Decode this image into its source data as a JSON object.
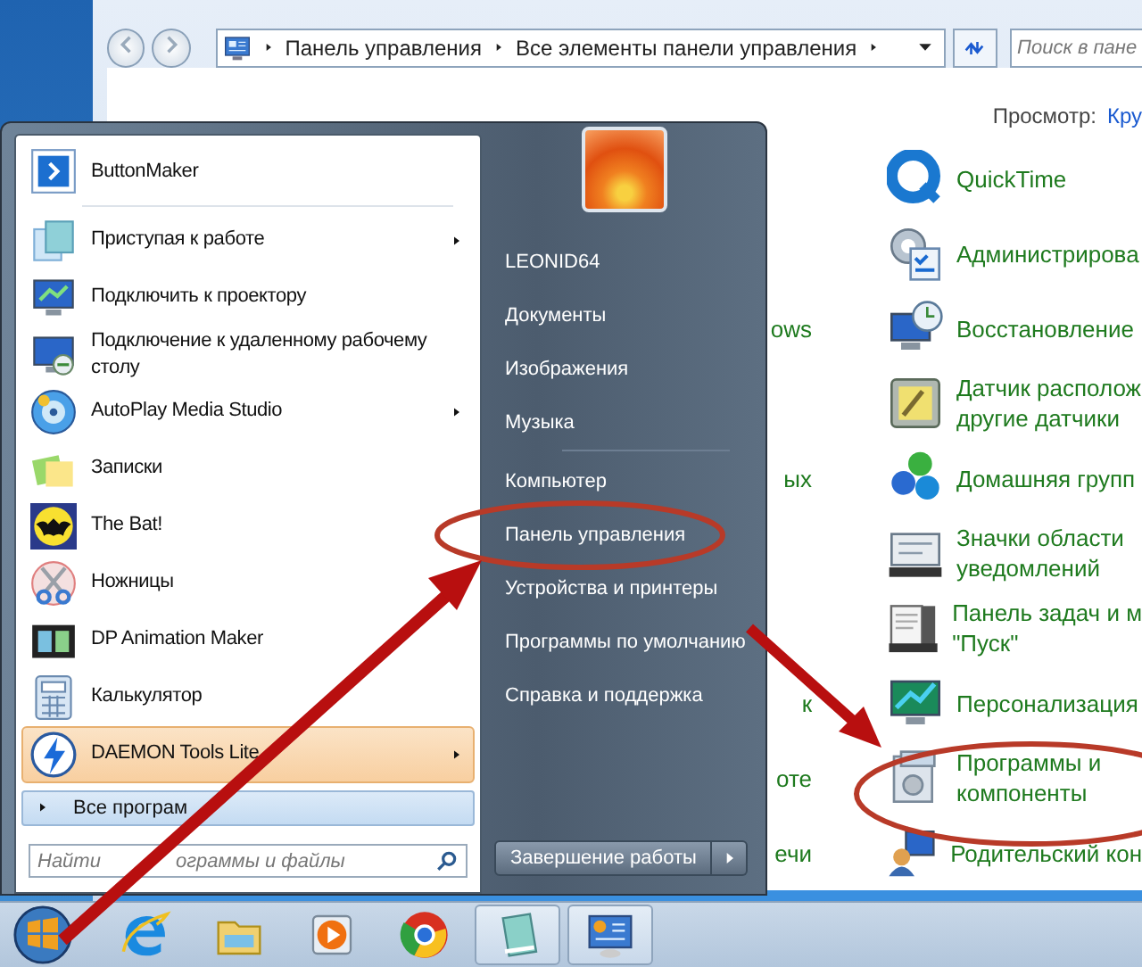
{
  "explorer": {
    "breadcrumb": [
      "Панель управления",
      "Все элементы панели управления"
    ],
    "search": {
      "placeholder": "Поиск в пане"
    },
    "view_label": "Просмотр:",
    "view_value": "Кру",
    "items": [
      {
        "lines": [
          "QuickTime"
        ]
      },
      {
        "lines": [
          "Администрирова"
        ]
      },
      {
        "lines": [
          "Восстановление"
        ],
        "left_fragment": "ows"
      },
      {
        "lines": [
          "Датчик располож",
          "другие датчики"
        ]
      },
      {
        "lines": [
          "Домашняя групп"
        ],
        "left_fragment": "ых"
      },
      {
        "lines": [
          "Значки области",
          "уведомлений"
        ]
      },
      {
        "lines": [
          "Панель задач и м",
          "\"Пуск\""
        ]
      },
      {
        "lines": [
          "Персонализация"
        ],
        "left_fragment": "к"
      },
      {
        "lines": [
          "Программы и",
          "компоненты"
        ],
        "left_fragment": "оте"
      },
      {
        "lines": [
          "Родительский кон"
        ],
        "left_fragment": "ечи"
      }
    ]
  },
  "start_menu": {
    "programs": [
      {
        "label": "ButtonMaker",
        "submenu": false,
        "selected": false
      },
      {
        "label": "Приступая к работе",
        "submenu": true,
        "selected": false
      },
      {
        "label": "Подключить к проектору",
        "submenu": false,
        "selected": false
      },
      {
        "label": "Подключение к удаленному рабочему столу",
        "submenu": false,
        "selected": false
      },
      {
        "label": "AutoPlay Media Studio",
        "submenu": true,
        "selected": false
      },
      {
        "label": "Записки",
        "submenu": false,
        "selected": false
      },
      {
        "label": "The Bat!",
        "submenu": false,
        "selected": false
      },
      {
        "label": "Ножницы",
        "submenu": false,
        "selected": false
      },
      {
        "label": "DP Animation Maker",
        "submenu": false,
        "selected": false
      },
      {
        "label": "Калькулятор",
        "submenu": false,
        "selected": false
      },
      {
        "label": "DAEMON Tools Lite",
        "submenu": true,
        "selected": true
      }
    ],
    "all_programs": "Все програм",
    "search": {
      "placeholder_parts": [
        "Найти",
        "ограммы и файлы"
      ]
    },
    "place_groups": [
      [
        "LEONID64",
        "Документы",
        "Изображения",
        "Музыка"
      ],
      [
        "Компьютер",
        "Панель управления",
        "Устройства и принтеры",
        "Программы по умолчанию",
        "Справка и поддержка"
      ]
    ],
    "shutdown": "Завершение работы"
  },
  "taskbar": {
    "items": [
      {
        "running": false
      },
      {
        "running": false
      },
      {
        "running": false
      },
      {
        "running": false
      },
      {
        "running": false
      },
      {
        "running": true
      },
      {
        "running": true
      }
    ]
  }
}
